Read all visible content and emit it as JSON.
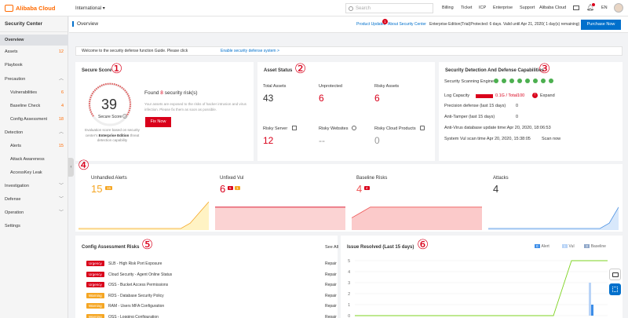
{
  "topbar": {
    "brand": "Alibaba Cloud",
    "region": "International",
    "search_placeholder": "Search",
    "nav": [
      "Billing",
      "Ticket",
      "ICP",
      "Enterprise",
      "Support",
      "Alibaba Cloud"
    ],
    "language": "EN"
  },
  "sidebar": {
    "title": "Security Center",
    "items": [
      {
        "label": "Overview",
        "active": true
      },
      {
        "label": "Assets",
        "count": "12"
      },
      {
        "label": "Playbook"
      },
      {
        "label": "Precaution",
        "expanded": true
      },
      {
        "label": "Vulnerabilities",
        "count": "6"
      },
      {
        "label": "Baseline Check",
        "count": "4"
      },
      {
        "label": "Config Assessment",
        "count": "18"
      },
      {
        "label": "Detection",
        "expanded": true
      },
      {
        "label": "Alerts",
        "count": "15"
      },
      {
        "label": "Attack Awareness"
      },
      {
        "label": "AccessKey Leak"
      },
      {
        "label": "Investigation"
      },
      {
        "label": "Defense"
      },
      {
        "label": "Operation"
      },
      {
        "label": "Settings"
      }
    ]
  },
  "page": {
    "title": "Overview",
    "product_updates": "Product Updates",
    "product_updates_badge": "1",
    "about": "About Security Center",
    "edition_info": "Enterprise Edition(Trial)Protected: 6 days. Valid until Apr 21, 2020( 1 day(s) remaining)",
    "purchase": "Purchase Now",
    "welcome": "Welcome to the security defense function Guide. Please click",
    "welcome_link": "Enable security defense system >"
  },
  "secure_score": {
    "title": "Secure Score",
    "score": "39",
    "score_label": "Secure Score",
    "found_prefix": "Found",
    "found_count": "8",
    "found_suffix": "security risk(s)",
    "desc": "Your assets are exposed to the risks of hacker intrusion and virus infection. Please fix them as soon as possible.",
    "fix": "Fix Now",
    "eval": "Evaluation score based on security center's",
    "eval_bold": "Enterprise Edition",
    "eval_end": "threat detection capability"
  },
  "asset_status": {
    "title": "Asset Status",
    "cells": [
      {
        "label": "Total Assets",
        "value": "43"
      },
      {
        "label": "Unprotected",
        "value": "6"
      },
      {
        "label": "Risky Assets",
        "value": "6"
      },
      {
        "label": "Risky Server",
        "value": "12"
      },
      {
        "label": "Risky Websites",
        "value": "--"
      },
      {
        "label": "Risky Cloud Products",
        "value": "0"
      }
    ]
  },
  "detection": {
    "title": "Security Detection And Defense Capabilities",
    "engine_label": "Security Scanning Engine",
    "log_capacity_label": "Log Capacity",
    "log_capacity_value": "0.1G / Total100",
    "log_capacity_badge": "!",
    "expand": "Expand",
    "precision": "Precision defense  (last 15 days)",
    "precision_value": "0",
    "anti_tamper": "Anti-Tamper  (last 15 days)",
    "anti_tamper_value": "0",
    "antivirus": "Anti-Virus database update time:Apr 20, 2020, 18:06:53",
    "scan_time": "System Vul scan time  Apr 20, 2020, 15:38:05",
    "scan_now": "Scan now"
  },
  "stats": [
    {
      "title": "Unhandled Alerts",
      "value": "15",
      "badges": [
        {
          "text": "15",
          "color": "#f5a623"
        }
      ],
      "color": "#f5a623",
      "fill": "#fff3c4",
      "trend": [
        0,
        0,
        0,
        0,
        0,
        0,
        0,
        0,
        0,
        0,
        0,
        0,
        1,
        3,
        5
      ]
    },
    {
      "title": "Unfixed Vul",
      "value": "6",
      "badges": [
        {
          "text": "5",
          "color": "#d9001b"
        },
        {
          "text": "1",
          "color": "#f5a623"
        }
      ],
      "color": "#d9001b",
      "fill": "#fbd3d3",
      "trend": [
        4,
        4,
        4,
        4,
        4,
        4,
        4,
        4,
        4,
        4,
        4,
        4,
        4,
        4,
        4
      ]
    },
    {
      "title": "Baseline Risks",
      "value": "4",
      "badges": [
        {
          "text": "4",
          "color": "#d9001b"
        }
      ],
      "color": "#e55",
      "fill": "#fbcaca",
      "trend": [
        2,
        3,
        4,
        4,
        4,
        4,
        4,
        4,
        4,
        4,
        4,
        4,
        4,
        4,
        4
      ]
    },
    {
      "title": "Attacks",
      "value": "4",
      "badges": [],
      "color": "#4a90e2",
      "fill": "#d8e8fb",
      "trend": [
        0,
        0,
        0,
        0,
        0,
        0,
        0,
        0,
        0,
        0,
        0,
        0,
        0,
        1,
        4
      ]
    }
  ],
  "config_risks": {
    "title": "Config Assessment Risks",
    "see_all": "See All",
    "rows": [
      {
        "level": "Urgency",
        "name": "SLB - High Risk Port Exposure",
        "action": "Repair"
      },
      {
        "level": "Urgency",
        "name": "Cloud Security - Agent Online Status",
        "action": "Repair"
      },
      {
        "level": "Urgency",
        "name": "OSS - Bucket Access Permissions",
        "action": "Repair"
      },
      {
        "level": "Warning",
        "name": "RDS - Database Security Policy",
        "action": "Repair"
      },
      {
        "level": "Warning",
        "name": "RAM - Users MFA Configuration",
        "action": "Repair"
      },
      {
        "level": "Warning",
        "name": "OSS - Logging Configuration",
        "action": "Repair"
      }
    ]
  },
  "issue_resolved": {
    "title": "Issue Resolved (Last 15 days)",
    "legend": [
      {
        "label": "Alert",
        "value": "0",
        "color": "#3d8ee8"
      },
      {
        "label": "Vul",
        "value": "1",
        "color": "#b9d4f7"
      },
      {
        "label": "Baseline",
        "value": "3",
        "color": "#8fa7c9"
      }
    ]
  },
  "chart_data": {
    "type": "line",
    "title": "Issue Resolved (Last 15 days)",
    "ylim": [
      0,
      5
    ],
    "yticks": [
      0,
      1,
      2,
      3,
      4,
      5
    ],
    "x_count": 15,
    "series": [
      {
        "name": "Baseline",
        "color": "#7ed321",
        "values": [
          0,
          0,
          0,
          0,
          0,
          0,
          0,
          0,
          0,
          0,
          0,
          0,
          5,
          5,
          5
        ]
      },
      {
        "name": "Vul",
        "color": "#b9d4f7",
        "values": [
          0,
          0,
          0,
          0,
          0,
          0,
          0,
          0,
          0,
          0,
          0,
          0,
          0,
          3,
          0
        ]
      },
      {
        "name": "Alert",
        "color": "#3d8ee8",
        "values": [
          0,
          0,
          0,
          0,
          0,
          0,
          0,
          0,
          0,
          0,
          0,
          0,
          0,
          1,
          0
        ]
      }
    ]
  },
  "markers": [
    "①",
    "②",
    "③",
    "④",
    "⑤",
    "⑥"
  ],
  "colors": {
    "accent": "#0070cc",
    "brand": "#ff6a00",
    "danger": "#d9001b",
    "warning": "#f5a623"
  }
}
